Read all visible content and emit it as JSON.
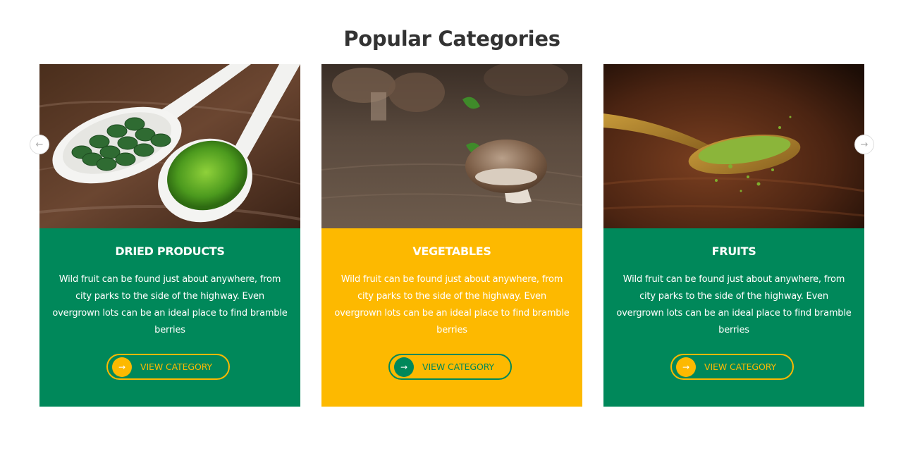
{
  "section": {
    "title": "Popular Categories"
  },
  "nav": {
    "prev_icon": "arrow-left-icon",
    "next_icon": "arrow-right-icon",
    "prev_glyph": "←",
    "next_glyph": "→"
  },
  "colors": {
    "green": "#00885a",
    "yellow": "#fdb900",
    "title": "#333333"
  },
  "cards": [
    {
      "title": "DRIED PRODUCTS",
      "description": "Wild fruit can be found just about anywhere, from city parks to the side of the highway. Even overgrown lots can be an ideal place to find bramble berries",
      "button_label": "VIEW CATEGORY",
      "button_icon": "arrow-right-icon",
      "button_glyph": "→",
      "image": "spirulina-tablets-and-powder-on-spoons"
    },
    {
      "title": "VEGETABLES",
      "description": "Wild fruit can be found just about anywhere, from city parks to the side of the highway. Even overgrown lots can be an ideal place to find bramble berries",
      "button_label": "VIEW CATEGORY",
      "button_icon": "arrow-right-icon",
      "button_glyph": "→",
      "image": "mushrooms-on-wooden-table"
    },
    {
      "title": "FRUITS",
      "description": "Wild fruit can be found just about anywhere, from city parks to the side of the highway. Even overgrown lots can be an ideal place to find bramble berries",
      "button_label": "VIEW CATEGORY",
      "button_icon": "arrow-right-icon",
      "button_glyph": "→",
      "image": "matcha-powder-on-wooden-spoon"
    }
  ]
}
